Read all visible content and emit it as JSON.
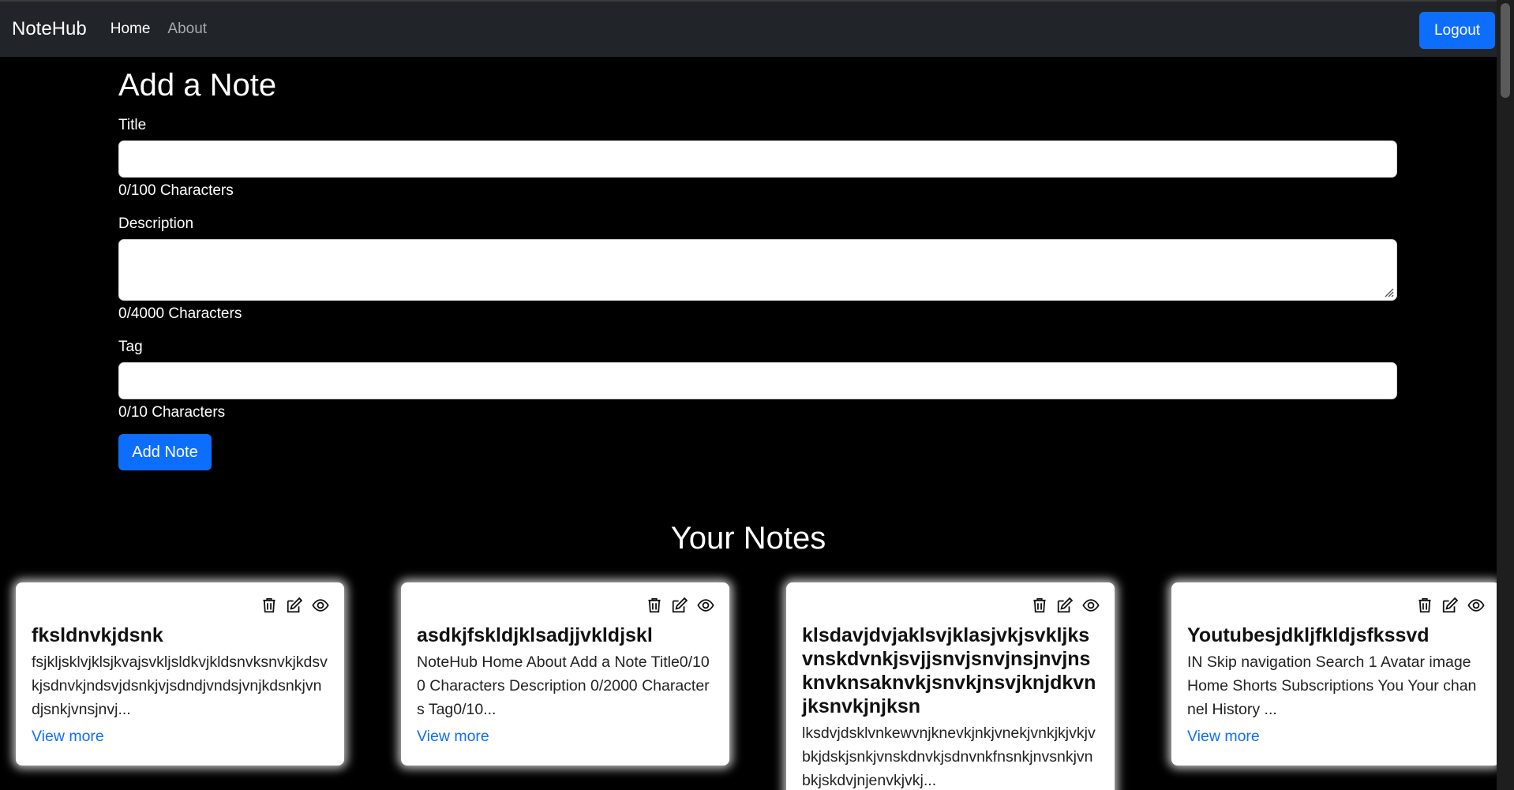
{
  "navbar": {
    "brand": "NoteHub",
    "links": [
      {
        "label": "Home",
        "active": true
      },
      {
        "label": "About",
        "active": false
      }
    ],
    "logout_label": "Logout"
  },
  "form": {
    "heading": "Add a Note",
    "title_label": "Title",
    "title_value": "",
    "title_counter": "0/100 Characters",
    "description_label": "Description",
    "description_value": "",
    "description_counter": "0/4000 Characters",
    "tag_label": "Tag",
    "tag_value": "",
    "tag_counter": "0/10 Characters",
    "submit_label": "Add Note"
  },
  "notes_section": {
    "heading": "Your Notes",
    "view_more_label": "View more",
    "notes": [
      {
        "title": "fksldnvkjdsnk",
        "description": "fsjkljsklvjklsjkvajsvkljsldkvjkldsnvksnvkjkdsvkjsdnvkjndsvjdsnkjvjsdndjvndsjvnjkdsnkjvndjsnkjvnsjnvj...",
        "show_view_more": true
      },
      {
        "title": "asdkjfskldjklsadjjvkldjskl",
        "description": "NoteHub Home About Add a Note Title0/100 Characters Description 0/2000 Characters Tag0/10...",
        "show_view_more": true
      },
      {
        "title": "klsdavjdvjaklsvjklasjvkjsvkljksvnskdvnkjsvjjsnvjsnvjnsjnvjnsknvknsaknvkjsnvkjnsvjknjdkvnjksnvkjnjksn",
        "description": "lksdvjdsklvnkewvnjknevkjnkjvnekjvnkjkjvkjvbkjdskjsnkjvnskdnvkjsdnvnkfnsnkjnvsnkjvnbkjskdvjnjenvkjvkj...",
        "show_view_more": false
      },
      {
        "title": "Youtubesjdkljfkldjsfkssvd",
        "description": "IN Skip navigation Search 1 Avatar image Home Shorts Subscriptions You Your channel History ...",
        "show_view_more": true
      }
    ]
  },
  "colors": {
    "primary": "#0d6efd",
    "navbar_bg": "#212529",
    "page_bg": "#000000"
  },
  "icons": [
    "trash-icon",
    "edit-icon",
    "eye-icon"
  ]
}
